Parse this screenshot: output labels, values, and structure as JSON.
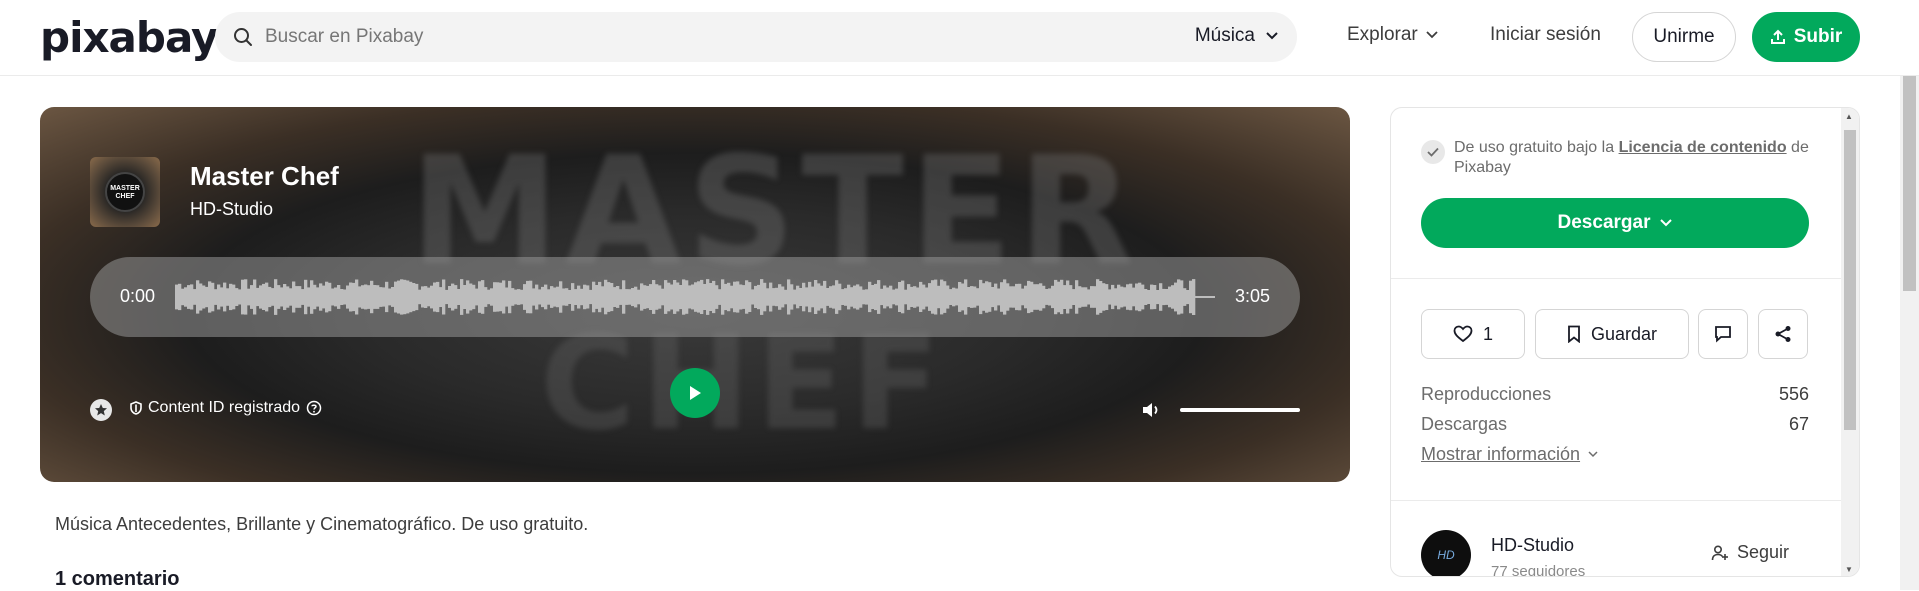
{
  "header": {
    "logo": "pixabay",
    "search_placeholder": "Buscar en Pixabay",
    "category": "Música",
    "explore": "Explorar",
    "login": "Iniciar sesión",
    "join": "Unirme",
    "upload": "Subir"
  },
  "player": {
    "title": "Master Chef",
    "artist": "HD-Studio",
    "time_current": "0:00",
    "time_total": "3:05",
    "content_id": "Content ID registrado",
    "thumb_text": "MASTER CHEF",
    "bg_text_1": "MASTER",
    "bg_text_2": "CHEF",
    "volume_level": 1.0
  },
  "description": "Música Antecedentes, Brillante y Cinematográfico. De uso gratuito.",
  "comments_heading": "1 comentario",
  "sidebar": {
    "license_prefix": "De uso gratuito bajo la",
    "license_link": "Licencia de contenido",
    "license_suffix": "de Pixabay",
    "download": "Descargar",
    "likes": "1",
    "save": "Guardar",
    "stats": [
      {
        "label": "Reproducciones",
        "value": "556"
      },
      {
        "label": "Descargas",
        "value": "67"
      }
    ],
    "more_info": "Mostrar información",
    "author": {
      "name": "HD-Studio",
      "followers": "77 seguidores",
      "avatar_text": "HD",
      "follow": "Seguir"
    }
  },
  "colors": {
    "accent": "#02a95c",
    "text": "#191b26",
    "muted": "#6c6c6c"
  }
}
